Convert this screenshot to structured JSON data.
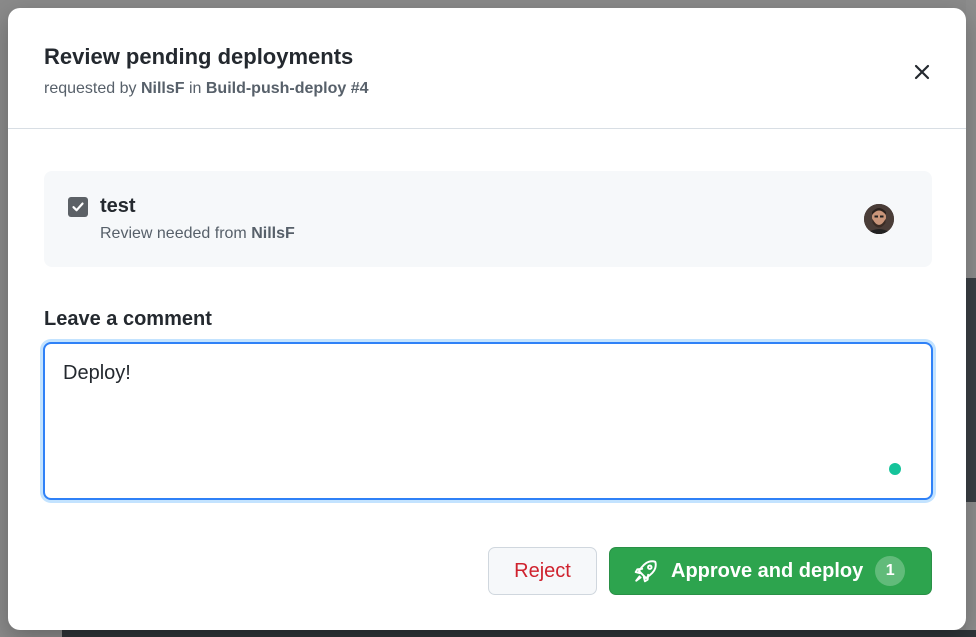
{
  "dialog": {
    "title": "Review pending deployments",
    "subtitle_prefix": "requested by ",
    "requester": "NillsF",
    "subtitle_mid": " in ",
    "workflow_run": "Build-push-deploy #4",
    "close_icon": "close-icon"
  },
  "environment": {
    "checked": true,
    "name": "test",
    "review_prefix": "Review needed from ",
    "reviewer": "NillsF"
  },
  "comment": {
    "label": "Leave a comment",
    "value": "Deploy!"
  },
  "actions": {
    "reject_label": "Reject",
    "approve_label": "Approve and deploy",
    "approve_count": "1",
    "approve_icon": "rocket-icon"
  },
  "colors": {
    "approve": "#2da44e",
    "reject_text": "#cf222e",
    "focus_border": "#2f81f7",
    "grammar_dot": "#15c39a"
  }
}
